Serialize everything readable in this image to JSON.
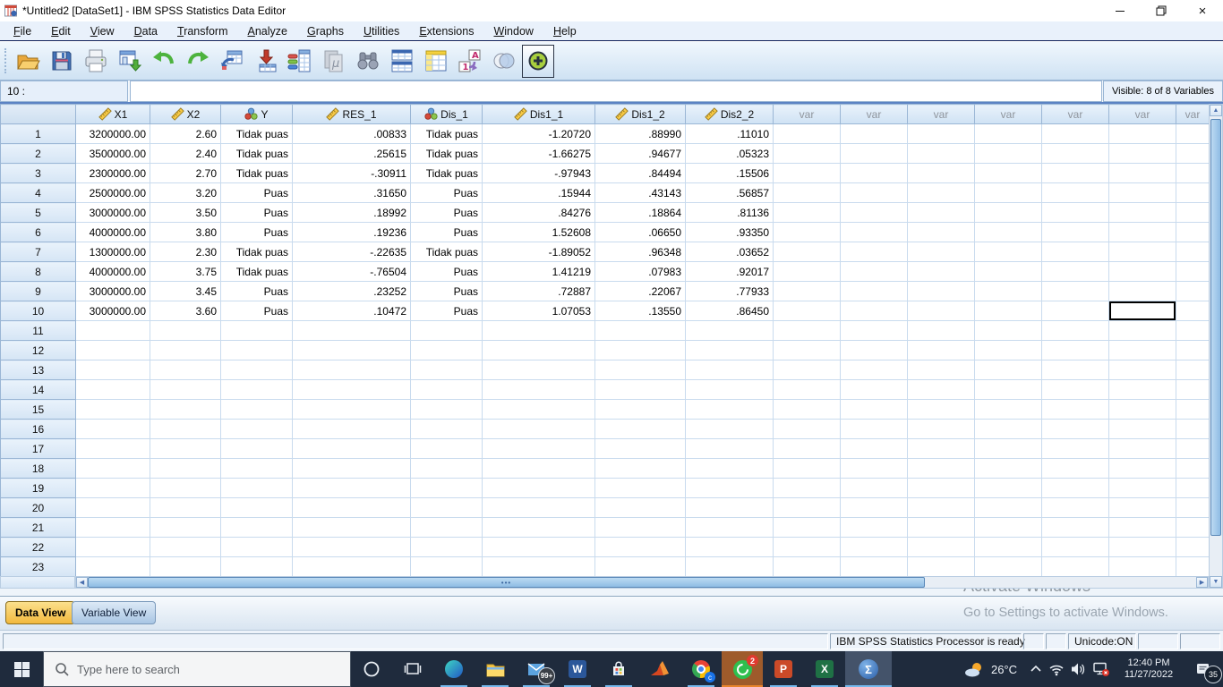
{
  "window": {
    "title": "*Untitled2 [DataSet1] - IBM SPSS Statistics Data Editor",
    "controls": [
      "minimize",
      "restore",
      "close"
    ]
  },
  "menu_bar": {
    "items": [
      "File",
      "Edit",
      "View",
      "Data",
      "Transform",
      "Analyze",
      "Graphs",
      "Utilities",
      "Extensions",
      "Window",
      "Help"
    ]
  },
  "toolbar": {
    "buttons": [
      {
        "name": "open-data"
      },
      {
        "name": "save"
      },
      {
        "name": "print"
      },
      {
        "name": "recall-dialogs"
      },
      {
        "name": "undo"
      },
      {
        "name": "redo"
      },
      {
        "name": "goto-case"
      },
      {
        "name": "goto-variable"
      },
      {
        "name": "variables"
      },
      {
        "name": "descriptives",
        "disabled": true
      },
      {
        "name": "find",
        "disabled": true
      },
      {
        "name": "split-file"
      },
      {
        "name": "weight-cases"
      },
      {
        "name": "value-labels"
      },
      {
        "name": "use-variable-sets"
      },
      {
        "name": "show-all-variables",
        "pressed": true
      }
    ]
  },
  "cell_reference": {
    "value": "10 :"
  },
  "variables_info": "Visible: 8 of 8 Variables",
  "grid": {
    "columns": [
      {
        "label": "X1",
        "measure": "scale"
      },
      {
        "label": "X2",
        "measure": "scale"
      },
      {
        "label": "Y",
        "measure": "nominal"
      },
      {
        "label": "RES_1",
        "measure": "scale"
      },
      {
        "label": "Dis_1",
        "measure": "nominal"
      },
      {
        "label": "Dis1_1",
        "measure": "scale"
      },
      {
        "label": "Dis1_2",
        "measure": "scale"
      },
      {
        "label": "Dis2_2",
        "measure": "scale"
      },
      {
        "label": "var"
      },
      {
        "label": "var"
      },
      {
        "label": "var"
      },
      {
        "label": "var"
      },
      {
        "label": "var"
      },
      {
        "label": "var"
      },
      {
        "label": "var"
      }
    ],
    "rows": [
      {
        "n": "1",
        "values": [
          "3200000.00",
          "2.60",
          "Tidak puas",
          ".00833",
          "Tidak puas",
          "-1.20720",
          ".88990",
          ".11010"
        ]
      },
      {
        "n": "2",
        "values": [
          "3500000.00",
          "2.40",
          "Tidak puas",
          ".25615",
          "Tidak puas",
          "-1.66275",
          ".94677",
          ".05323"
        ]
      },
      {
        "n": "3",
        "values": [
          "2300000.00",
          "2.70",
          "Tidak puas",
          "-.30911",
          "Tidak puas",
          "-.97943",
          ".84494",
          ".15506"
        ]
      },
      {
        "n": "4",
        "values": [
          "2500000.00",
          "3.20",
          "Puas",
          ".31650",
          "Puas",
          ".15944",
          ".43143",
          ".56857"
        ]
      },
      {
        "n": "5",
        "values": [
          "3000000.00",
          "3.50",
          "Puas",
          ".18992",
          "Puas",
          ".84276",
          ".18864",
          ".81136"
        ]
      },
      {
        "n": "6",
        "values": [
          "4000000.00",
          "3.80",
          "Puas",
          ".19236",
          "Puas",
          "1.52608",
          ".06650",
          ".93350"
        ]
      },
      {
        "n": "7",
        "values": [
          "1300000.00",
          "2.30",
          "Tidak puas",
          "-.22635",
          "Tidak puas",
          "-1.89052",
          ".96348",
          ".03652"
        ]
      },
      {
        "n": "8",
        "values": [
          "4000000.00",
          "3.75",
          "Tidak puas",
          "-.76504",
          "Puas",
          "1.41219",
          ".07983",
          ".92017"
        ]
      },
      {
        "n": "9",
        "values": [
          "3000000.00",
          "3.45",
          "Puas",
          ".23252",
          "Puas",
          ".72887",
          ".22067",
          ".77933"
        ]
      },
      {
        "n": "10",
        "values": [
          "3000000.00",
          "3.60",
          "Puas",
          ".10472",
          "Puas",
          "1.07053",
          ".13550",
          ".86450"
        ]
      }
    ],
    "empty_rows": [
      "11",
      "12",
      "13",
      "14",
      "15",
      "16",
      "17",
      "18",
      "19",
      "20",
      "21",
      "22",
      "23"
    ],
    "selected_cell": {
      "row": "10",
      "column_index": 13
    }
  },
  "tabs": {
    "items": [
      {
        "label": "Data View",
        "active": true
      },
      {
        "label": "Variable View",
        "active": false
      }
    ]
  },
  "status_bar": {
    "processor": "IBM SPSS Statistics Processor is ready",
    "unicode": "Unicode:ON"
  },
  "watermark": {
    "line1": "Activate Windows",
    "line2": "Go to Settings to activate Windows."
  },
  "taskbar": {
    "search_placeholder": "Type here to search",
    "apps": [
      "start",
      "search",
      "cortana",
      "task-view",
      "edge",
      "file-explorer",
      "mail",
      "word",
      "store",
      "matlab",
      "chrome",
      "whatsapp",
      "powerpoint",
      "excel",
      "spss"
    ],
    "badges": {
      "mail": "99+",
      "whatsapp": "2",
      "chrome": "c",
      "notifications": "35"
    },
    "tray": {
      "temperature": "26°C",
      "time": "12:40 PM",
      "date": "11/27/2022"
    }
  },
  "colors": {
    "active_tab": "#f2b93e",
    "taskbar": "#1f2b3d",
    "whatsapp_highlight": "#9e5b2b",
    "grid_line": "#c9dbee",
    "header_fill": "#d9e8f7"
  }
}
